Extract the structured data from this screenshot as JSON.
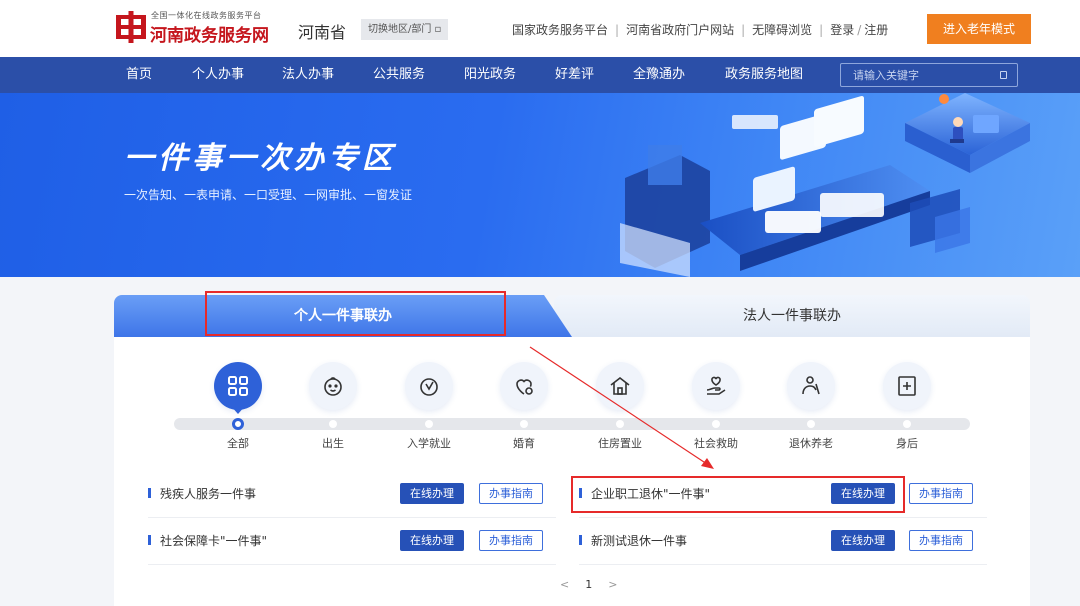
{
  "header": {
    "logo_sub": "全国一体化在线政务服务平台",
    "logo_main": "河南政务服务网",
    "province": "河南省",
    "switch_region": "切换地区/部门 ▫",
    "links": [
      "国家政务服务平台",
      "河南省政府门户网站",
      "无障碍浏览",
      "登录",
      "注册"
    ],
    "elder_mode": "进入老年模式",
    "logo_color": "#c5161d"
  },
  "nav": {
    "items": [
      "首页",
      "个人办事",
      "法人办事",
      "公共服务",
      "阳光政务",
      "好差评",
      "全豫通办",
      "政务服务地图"
    ],
    "search_placeholder": "请输入关键字",
    "bg_color": "#2b4fa8"
  },
  "banner": {
    "title": "一件事一次办专区",
    "subtitle": "一次告知、一表申请、一口受理、一网审批、一窗发证"
  },
  "tabs": {
    "personal": "个人一件事联办",
    "corporate": "法人一件事联办",
    "active": "personal"
  },
  "categories": [
    {
      "label": "全部",
      "icon": "grid-icon",
      "active": true
    },
    {
      "label": "出生",
      "icon": "baby-icon",
      "active": false
    },
    {
      "label": "入学就业",
      "icon": "medal-icon",
      "active": false
    },
    {
      "label": "婚育",
      "icon": "heart-icon",
      "active": false
    },
    {
      "label": "住房置业",
      "icon": "house-icon",
      "active": false
    },
    {
      "label": "社会救助",
      "icon": "hand-heart-icon",
      "active": false
    },
    {
      "label": "退休养老",
      "icon": "elder-icon",
      "active": false
    },
    {
      "label": "身后",
      "icon": "plus-box-icon",
      "active": false
    }
  ],
  "services": [
    {
      "name": "残疾人服务一件事",
      "online": "在线办理",
      "guide": "办事指南"
    },
    {
      "name": "企业职工退休\"一件事\"",
      "online": "在线办理",
      "guide": "办事指南"
    },
    {
      "name": "社会保障卡\"一件事\"",
      "online": "在线办理",
      "guide": "办事指南"
    },
    {
      "name": "新测试退休一件事",
      "online": "在线办理",
      "guide": "办事指南"
    }
  ],
  "pager": {
    "prev": "<",
    "current": "1",
    "next": ">"
  },
  "colors": {
    "primary": "#2e61d8",
    "accent": "#f07f1f",
    "annotation": "#e62a2a"
  }
}
